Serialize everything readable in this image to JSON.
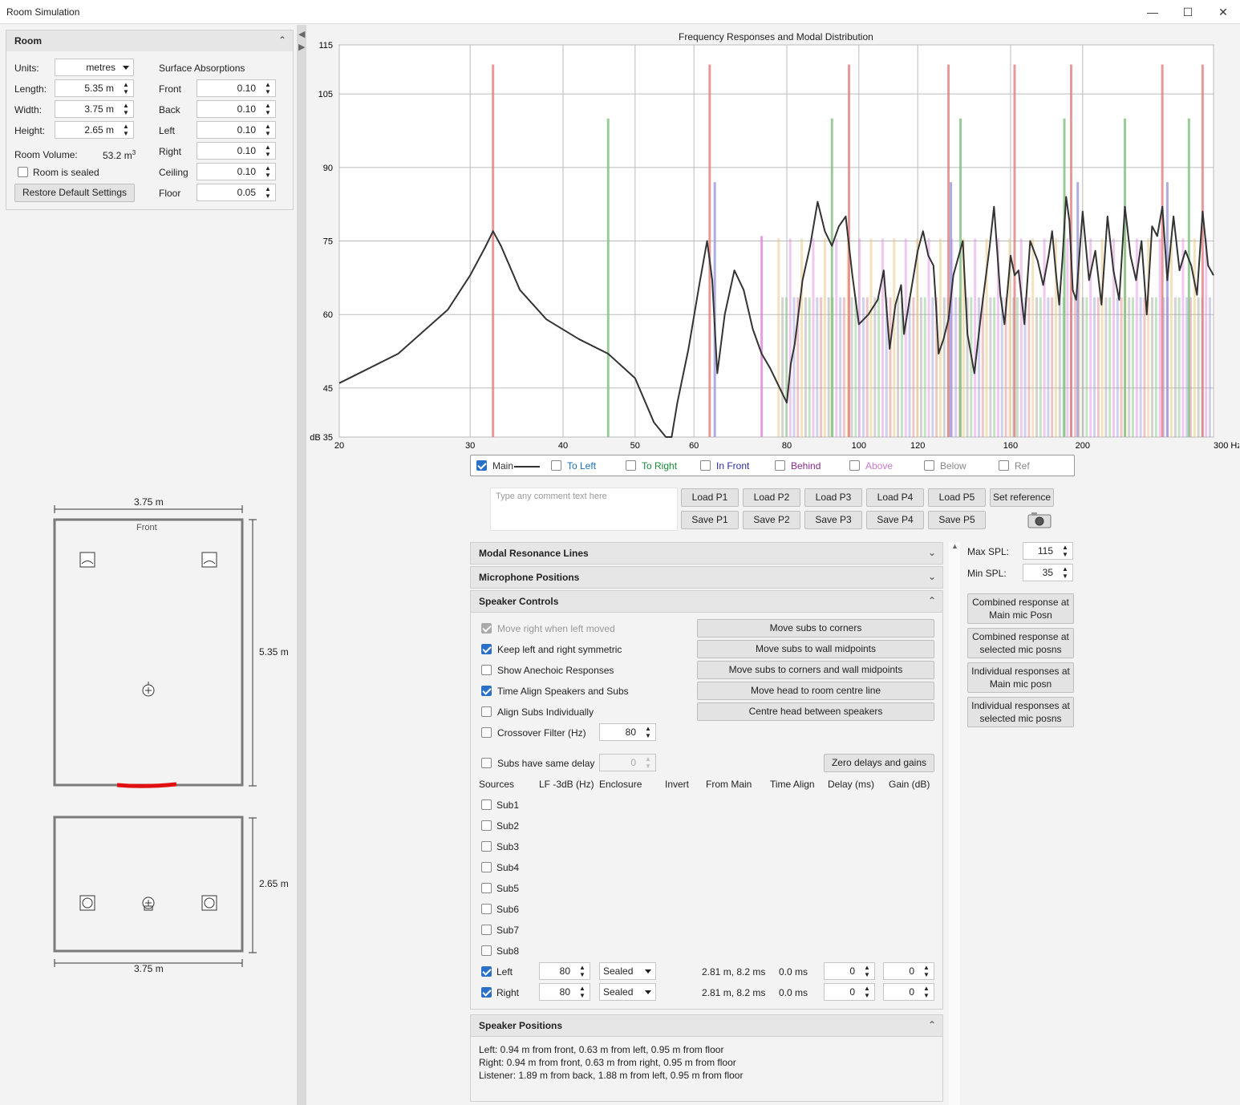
{
  "window": {
    "title": "Room Simulation"
  },
  "room": {
    "header": "Room",
    "units_label": "Units:",
    "units_value": "metres",
    "length_label": "Length:",
    "length_value": "5.35 m",
    "width_label": "Width:",
    "width_value": "3.75 m",
    "height_label": "Height:",
    "height_value": "2.65 m",
    "volume_label": "Room Volume:",
    "volume_value": "53.2 m",
    "volume_sup": "3",
    "sealed_label": "Room is sealed",
    "sealed_checked": false,
    "restore_label": "Restore Default Settings",
    "absorptions_label": "Surface Absorptions",
    "surfaces": [
      {
        "name": "Front",
        "value": "0.10"
      },
      {
        "name": "Back",
        "value": "0.10"
      },
      {
        "name": "Left",
        "value": "0.10"
      },
      {
        "name": "Right",
        "value": "0.10"
      },
      {
        "name": "Ceiling",
        "value": "0.10"
      },
      {
        "name": "Floor",
        "value": "0.05"
      }
    ]
  },
  "plan": {
    "top_width": "3.75 m",
    "length": "5.35 m",
    "front": "Front",
    "height": "2.65 m",
    "bottom_width": "3.75 m"
  },
  "chart_data": {
    "type": "line",
    "title": "Frequency Responses and Modal Distribution",
    "x_scale": "log",
    "xlim": [
      20,
      300
    ],
    "ylim": [
      35,
      115
    ],
    "x_ticks": [
      20,
      30,
      40,
      50,
      60,
      80,
      100,
      120,
      160,
      200,
      300
    ],
    "x_tick_labels": [
      "20",
      "30",
      "40",
      "50",
      "60",
      "80",
      "100",
      "120",
      "160",
      "200",
      "300 Hz"
    ],
    "y_ticks": [
      35,
      45,
      60,
      75,
      90,
      105,
      115
    ],
    "y_tick_labels": [
      "dB 35",
      "45",
      "60",
      "75",
      "90",
      "105",
      "115"
    ],
    "series": [
      {
        "name": "Main",
        "color": "#333333",
        "x": [
          20,
          24,
          28,
          30,
          31.5,
          32.2,
          33,
          35,
          38,
          42,
          46,
          50,
          53,
          55,
          56,
          57,
          59,
          61,
          62.5,
          63.5,
          64.5,
          66,
          68,
          70,
          72,
          74,
          76,
          80,
          81,
          82,
          84,
          86,
          88,
          90,
          92,
          94,
          96,
          98,
          100,
          103,
          106,
          108,
          110,
          112,
          114,
          115,
          117,
          120,
          122,
          124,
          126,
          127,
          128,
          130,
          132,
          134,
          138,
          140,
          143,
          146,
          150,
          152,
          155,
          157,
          160,
          162,
          164,
          167,
          170,
          174,
          177,
          180,
          182,
          184,
          186,
          188,
          190,
          192,
          194,
          196,
          200,
          204,
          208,
          212,
          216,
          220,
          224,
          228,
          232,
          236,
          240,
          244,
          248,
          252,
          256,
          260,
          265,
          270,
          275,
          280,
          285,
          290,
          295,
          300
        ],
        "y": [
          46,
          52,
          61,
          68,
          74,
          77,
          74,
          65,
          59,
          55,
          52,
          47,
          38,
          28,
          32,
          42,
          53,
          66,
          75,
          67,
          48,
          60,
          69,
          65,
          57,
          52,
          49,
          42,
          50,
          54,
          67,
          74,
          83,
          77,
          74,
          78,
          80,
          68,
          58,
          60,
          63,
          69,
          53,
          62,
          66,
          56,
          63,
          73,
          77,
          72,
          70,
          62,
          52,
          55,
          59,
          68,
          75,
          56,
          48,
          60,
          74,
          82,
          64,
          58,
          72,
          68,
          69,
          58,
          75,
          71,
          66,
          72,
          77,
          69,
          62,
          72,
          84,
          79,
          65,
          63,
          81,
          67,
          73,
          62,
          80,
          69,
          63,
          82,
          72,
          67,
          75,
          60,
          78,
          76,
          82,
          67,
          80,
          69,
          73,
          70,
          64,
          81,
          70,
          68
        ]
      }
    ],
    "modal_lines": [
      {
        "x": 32.2,
        "top": 111,
        "color": "#e08080"
      },
      {
        "x": 46,
        "top": 100,
        "color": "#80c080"
      },
      {
        "x": 63,
        "top": 111,
        "color": "#e08080"
      },
      {
        "x": 64,
        "top": 87,
        "color": "#9999dd"
      },
      {
        "x": 74,
        "top": 76,
        "color": "#dd88dd"
      },
      {
        "x": 92,
        "top": 100,
        "color": "#80c080"
      },
      {
        "x": 97,
        "top": 111,
        "color": "#e08080"
      },
      {
        "x": 132,
        "top": 111,
        "color": "#e08080"
      },
      {
        "x": 133,
        "top": 87,
        "color": "#9999dd"
      },
      {
        "x": 137,
        "top": 100,
        "color": "#80c080"
      },
      {
        "x": 162,
        "top": 111,
        "color": "#e08080"
      },
      {
        "x": 189,
        "top": 100,
        "color": "#80c080"
      },
      {
        "x": 193,
        "top": 111,
        "color": "#e08080"
      },
      {
        "x": 197,
        "top": 87,
        "color": "#9999dd"
      },
      {
        "x": 228,
        "top": 100,
        "color": "#80c080"
      },
      {
        "x": 256,
        "top": 111,
        "color": "#e08080"
      },
      {
        "x": 260,
        "top": 87,
        "color": "#9999dd"
      },
      {
        "x": 278,
        "top": 100,
        "color": "#80c080"
      },
      {
        "x": 290,
        "top": 111,
        "color": "#e08080"
      }
    ],
    "legend": [
      {
        "label": "Main",
        "checked": true,
        "color": "#333333",
        "line": true
      },
      {
        "label": "To Left",
        "checked": false,
        "color": "#1a6fb8"
      },
      {
        "label": "To Right",
        "checked": false,
        "color": "#1a8a3a"
      },
      {
        "label": "In Front",
        "checked": false,
        "color": "#2a2aa0"
      },
      {
        "label": "Behind",
        "checked": false,
        "color": "#8a2a8a"
      },
      {
        "label": "Above",
        "checked": false,
        "color": "#cc77cc"
      },
      {
        "label": "Below",
        "checked": false,
        "color": "#888888"
      },
      {
        "label": "Ref",
        "checked": false,
        "color": "#888888"
      }
    ]
  },
  "comment": {
    "placeholder": "Type any comment text here"
  },
  "presets": {
    "load": [
      "Load P1",
      "Load P2",
      "Load P3",
      "Load P4",
      "Load P5"
    ],
    "save": [
      "Save P1",
      "Save P2",
      "Save P3",
      "Save P4",
      "Save P5"
    ],
    "set_reference": "Set reference"
  },
  "sections": {
    "modal": "Modal Resonance Lines",
    "mic": "Microphone Positions",
    "speaker": "Speaker Controls",
    "positions": "Speaker Positions"
  },
  "speaker_controls": {
    "options": [
      {
        "label": "Move right when left moved",
        "checked": true,
        "disabled": true
      },
      {
        "label": "Keep left and right symmetric",
        "checked": true
      },
      {
        "label": "Show Anechoic Responses",
        "checked": false
      },
      {
        "label": "Time Align Speakers and Subs",
        "checked": true
      },
      {
        "label": "Align Subs Individually",
        "checked": false
      },
      {
        "label": "Crossover Filter (Hz)",
        "checked": false
      }
    ],
    "crossover_value": "80",
    "subs_same_delay_label": "Subs have same delay",
    "subs_same_delay_value": "0",
    "buttons": [
      "Move subs to corners",
      "Move subs to wall midpoints",
      "Move subs to corners and wall midpoints",
      "Move head to room centre line",
      "Centre head between speakers"
    ],
    "zero_button": "Zero delays and gains",
    "columns": [
      "Sources",
      "LF -3dB (Hz)",
      "Enclosure",
      "Invert",
      "From Main",
      "Time Align",
      "Delay (ms)",
      "Gain (dB)"
    ],
    "subs": [
      "Sub1",
      "Sub2",
      "Sub3",
      "Sub4",
      "Sub5",
      "Sub6",
      "Sub7",
      "Sub8"
    ],
    "mains": [
      {
        "name": "Left",
        "checked": true,
        "lf": "80",
        "enclosure": "Sealed",
        "from_main": "2.81 m, 8.2 ms",
        "time_align": "0.0 ms",
        "delay": "0",
        "gain": "0"
      },
      {
        "name": "Right",
        "checked": true,
        "lf": "80",
        "enclosure": "Sealed",
        "from_main": "2.81 m, 8.2 ms",
        "time_align": "0.0 ms",
        "delay": "0",
        "gain": "0"
      }
    ]
  },
  "speaker_positions": [
    "Left: 0.94 m from front, 0.63 m from left, 0.95 m from floor",
    "Right: 0.94 m from front, 0.63 m from right, 0.95 m from floor",
    "Listener: 1.89 m from back, 1.88 m from left, 0.95 m from floor"
  ],
  "spl": {
    "max_label": "Max SPL:",
    "max_value": "115",
    "min_label": "Min SPL:",
    "min_value": "35"
  },
  "response_buttons": [
    [
      "Combined response at",
      "Main mic Posn"
    ],
    [
      "Combined response at",
      "selected mic posns"
    ],
    [
      "Individual responses at",
      "Main mic posn"
    ],
    [
      "Individual responses at",
      "selected mic posns"
    ]
  ]
}
